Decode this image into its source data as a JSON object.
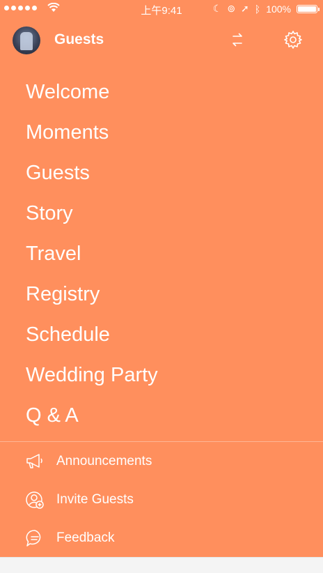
{
  "colors": {
    "background": "#ff8f5d",
    "bottom_strip": "#f4f4f4"
  },
  "status_bar": {
    "time": "上午9:41",
    "battery": "100%"
  },
  "header": {
    "title": "Guests",
    "avatar_icon": "avatar",
    "switch_icon": "swap-arrows-icon",
    "settings_icon": "gear-icon"
  },
  "menu": [
    {
      "label": "Welcome"
    },
    {
      "label": "Moments"
    },
    {
      "label": "Guests"
    },
    {
      "label": "Story"
    },
    {
      "label": "Travel"
    },
    {
      "label": "Registry"
    },
    {
      "label": "Schedule"
    },
    {
      "label": "Wedding Party"
    },
    {
      "label": "Q & A"
    }
  ],
  "bottom_menu": [
    {
      "label": "Announcements",
      "icon": "megaphone-icon"
    },
    {
      "label": "Invite Guests",
      "icon": "invite-user-icon"
    },
    {
      "label": "Feedback",
      "icon": "chat-bubble-icon"
    }
  ]
}
